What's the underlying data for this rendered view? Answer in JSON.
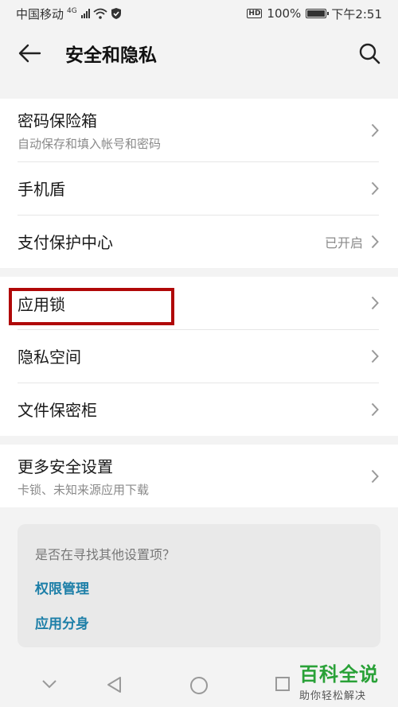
{
  "status_bar": {
    "carrier": "中国移动",
    "network": "4G",
    "battery_badge": "HD",
    "battery_percent": "100%",
    "time": "下午2:51"
  },
  "header": {
    "title": "安全和隐私"
  },
  "group1": [
    {
      "title": "密码保险箱",
      "subtitle": "自动保存和填入帐号和密码"
    },
    {
      "title": "手机盾"
    },
    {
      "title": "支付保护中心",
      "value": "已开启"
    }
  ],
  "group2": [
    {
      "title": "应用锁"
    },
    {
      "title": "隐私空间"
    },
    {
      "title": "文件保密柜"
    }
  ],
  "group3": [
    {
      "title": "更多安全设置",
      "subtitle": "卡锁、未知来源应用下载"
    }
  ],
  "tips": {
    "question": "是否在寻找其他设置项？",
    "links": [
      "权限管理",
      "应用分身"
    ]
  },
  "watermark": {
    "main": "百科全说",
    "sub": "助你轻松解决"
  },
  "colors": {
    "highlight_box": "#b00808",
    "link": "#1d7fa8",
    "watermark": "#29a137"
  }
}
